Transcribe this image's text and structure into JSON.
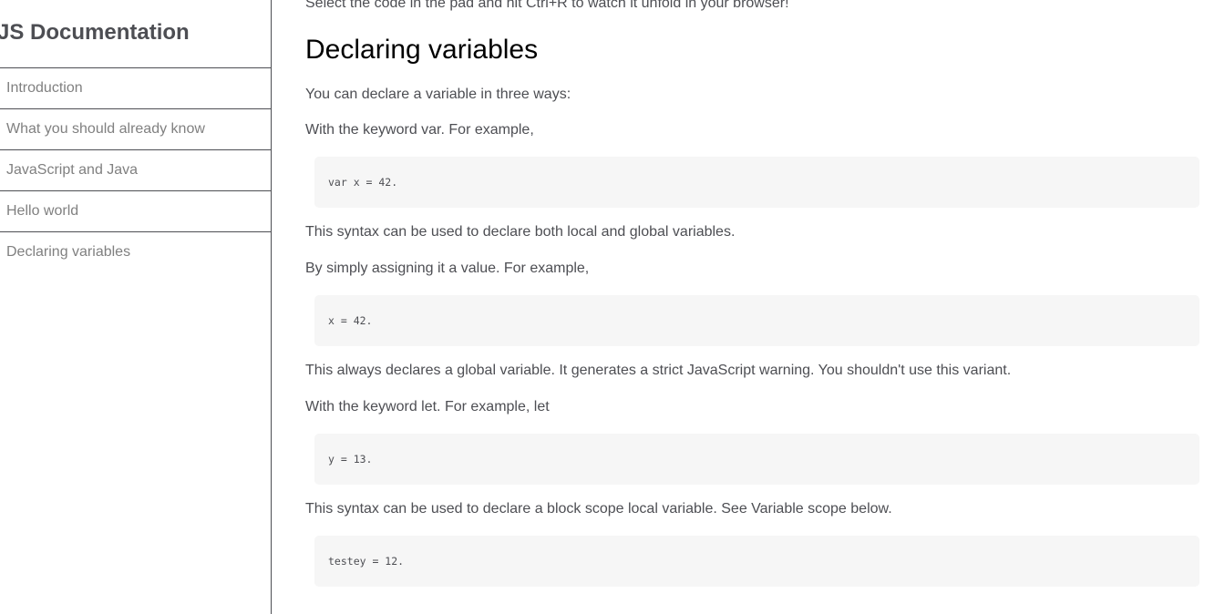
{
  "sidebar": {
    "title": "JS Documentation",
    "items": [
      {
        "label": "Introduction"
      },
      {
        "label": "What you should already know"
      },
      {
        "label": "JavaScript and Java"
      },
      {
        "label": "Hello world"
      },
      {
        "label": "Declaring variables"
      }
    ]
  },
  "main": {
    "intro_tail": "Select the code in the pad and hit Ctrl+R to watch it unfold in your browser!",
    "section_title": "Declaring variables",
    "p1": "You can declare a variable in three ways:",
    "p2": "With the keyword var. For example,",
    "code1": "var x = 42.",
    "p3": "This syntax can be used to declare both local and global variables.",
    "p4": "By simply assigning it a value. For example,",
    "code2": "x = 42.",
    "p5": "This always declares a global variable. It generates a strict JavaScript warning. You shouldn't use this variant.",
    "p6": "With the keyword let. For example, let",
    "code3": "y = 13.",
    "p7": "This syntax can be used to declare a block scope local variable. See Variable scope below.",
    "code4": "testey = 12."
  }
}
